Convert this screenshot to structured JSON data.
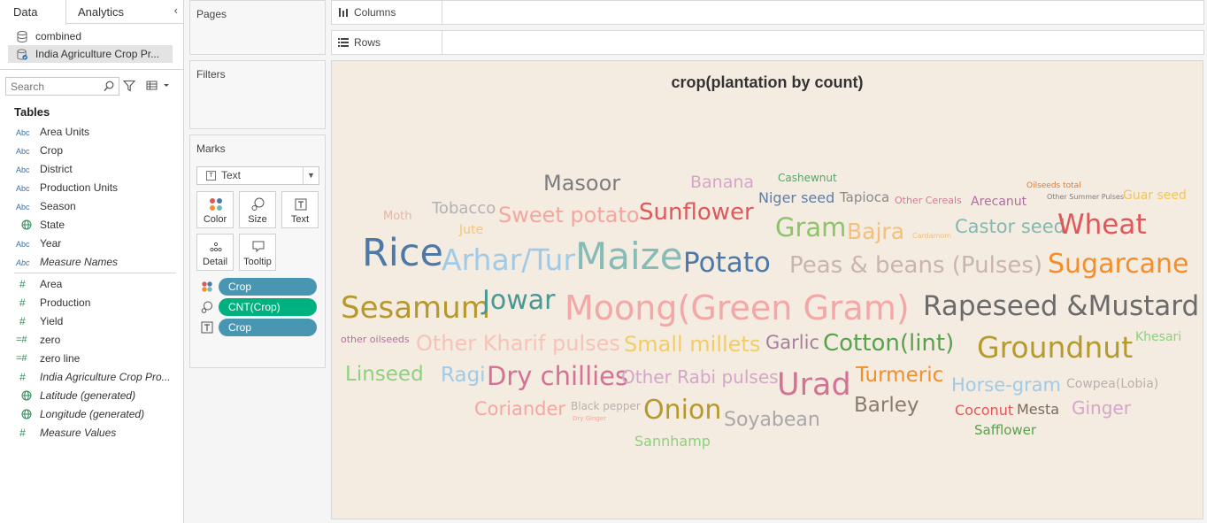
{
  "data_pane": {
    "tabs": {
      "data": "Data",
      "analytics": "Analytics"
    },
    "datasources": [
      {
        "name": "combined"
      },
      {
        "name": "India Agriculture Crop Pr..."
      }
    ],
    "search": {
      "placeholder": "Search"
    },
    "tables_heading": "Tables",
    "dimensions": [
      {
        "label": "Area Units",
        "type": "abc"
      },
      {
        "label": "Crop",
        "type": "abc"
      },
      {
        "label": "District",
        "type": "abc"
      },
      {
        "label": "Production Units",
        "type": "abc"
      },
      {
        "label": "Season",
        "type": "abc"
      },
      {
        "label": "State",
        "type": "geo"
      },
      {
        "label": "Year",
        "type": "abc"
      },
      {
        "label": "Measure Names",
        "type": "abc",
        "italic": true
      }
    ],
    "measures": [
      {
        "label": "Area",
        "type": "num"
      },
      {
        "label": "Production",
        "type": "num"
      },
      {
        "label": "Yield",
        "type": "num"
      },
      {
        "label": "zero",
        "type": "calc"
      },
      {
        "label": "zero line",
        "type": "calc"
      },
      {
        "label": "India Agriculture Crop Pro...",
        "type": "num",
        "italic": true
      },
      {
        "label": "Latitude (generated)",
        "type": "geo",
        "italic": true
      },
      {
        "label": "Longitude (generated)",
        "type": "geo",
        "italic": true
      },
      {
        "label": "Measure Values",
        "type": "num",
        "italic": true
      }
    ]
  },
  "cards": {
    "pages": "Pages",
    "filters": "Filters",
    "marks": {
      "title": "Marks",
      "mark_type": "Text",
      "buttons": {
        "color": "Color",
        "size": "Size",
        "text": "Text",
        "detail": "Detail",
        "tooltip": "Tooltip"
      },
      "pills": [
        {
          "label": "Crop",
          "kind": "color",
          "pill_color": "#4996b2"
        },
        {
          "label": "CNT(Crop)",
          "kind": "size",
          "pill_color": "#00b180"
        },
        {
          "label": "Crop",
          "kind": "text",
          "pill_color": "#4996b2"
        }
      ]
    }
  },
  "shelves": {
    "columns": "Columns",
    "rows": "Rows"
  },
  "viz": {
    "title": "crop(plantation by count)",
    "words": [
      {
        "text": "Masoor",
        "color": "#7d7d7d"
      },
      {
        "text": "Banana",
        "color": "#d4a6c8"
      },
      {
        "text": "Cashewnut",
        "color": "#59a36b"
      },
      {
        "text": "Niger seed",
        "color": "#5b7eaa"
      },
      {
        "text": "Tapioca",
        "color": "#8a8a8a"
      },
      {
        "text": "Other Cereals",
        "color": "#d47a95"
      },
      {
        "text": "Arecanut",
        "color": "#b06ea0"
      },
      {
        "text": "Oilseeds total",
        "color": "#e07a2e"
      },
      {
        "text": "Other Summer Pulses",
        "color": "#7d7d7d"
      },
      {
        "text": "Guar seed",
        "color": "#f1c659"
      },
      {
        "text": "Moth",
        "color": "#e5b5a5"
      },
      {
        "text": "Tobacco",
        "color": "#b3b3b3"
      },
      {
        "text": "Sweet potato",
        "color": "#f4a7a0"
      },
      {
        "text": "Sunflower",
        "color": "#e0585a"
      },
      {
        "text": "Gram",
        "color": "#8dc46a"
      },
      {
        "text": "Bajra",
        "color": "#f4c07a"
      },
      {
        "text": "Cardamom",
        "color": "#f4c07a"
      },
      {
        "text": "Castor seed",
        "color": "#86b8b0"
      },
      {
        "text": "Wheat",
        "color": "#e05759"
      },
      {
        "text": "Jute",
        "color": "#f7c479"
      },
      {
        "text": "Rice",
        "color": "#4e79a7"
      },
      {
        "text": "Arhar/Tur",
        "color": "#a0cbe8"
      },
      {
        "text": "Maize",
        "color": "#86bcb6"
      },
      {
        "text": "Potato",
        "color": "#4e79a7"
      },
      {
        "text": "Peas & beans (Pulses)",
        "color": "#c9b5b0"
      },
      {
        "text": "Sugarcane",
        "color": "#f28e2b"
      },
      {
        "text": "Sesamum",
        "color": "#b6992d"
      },
      {
        "text": "Jowar",
        "color": "#499894"
      },
      {
        "text": "Moong(Green Gram)",
        "color": "#f4a7a7"
      },
      {
        "text": "Rapeseed &Mustard",
        "color": "#6b6b6b"
      },
      {
        "text": "other oilseeds",
        "color": "#b16f9f"
      },
      {
        "text": "Other Kharif pulses",
        "color": "#f7c3b8"
      },
      {
        "text": "Small millets",
        "color": "#f1ce63"
      },
      {
        "text": "Garlic",
        "color": "#a67fa0"
      },
      {
        "text": "Cotton(lint)",
        "color": "#59a14f"
      },
      {
        "text": "Groundnut",
        "color": "#b69a2d"
      },
      {
        "text": "Khesari",
        "color": "#8cd17d"
      },
      {
        "text": "Linseed",
        "color": "#8cd17d"
      },
      {
        "text": "Ragi",
        "color": "#a0cbe8"
      },
      {
        "text": "Dry chillies",
        "color": "#d37295"
      },
      {
        "text": "Other Rabi pulses",
        "color": "#d4a6c8"
      },
      {
        "text": "Urad",
        "color": "#d37295"
      },
      {
        "text": "Turmeric",
        "color": "#f28e2b"
      },
      {
        "text": "Horse-gram",
        "color": "#a0cbe8"
      },
      {
        "text": "Cowpea(Lobia)",
        "color": "#bab0ac"
      },
      {
        "text": "Coriander",
        "color": "#f4a7a0"
      },
      {
        "text": "Black pepper",
        "color": "#bab0ac"
      },
      {
        "text": "Dry Ginger",
        "color": "#f4a7a0"
      },
      {
        "text": "Onion",
        "color": "#b6992d"
      },
      {
        "text": "Soyabean",
        "color": "#a8a8a8"
      },
      {
        "text": "Barley",
        "color": "#8a7b6a"
      },
      {
        "text": "Coconut",
        "color": "#e15759"
      },
      {
        "text": "Mesta",
        "color": "#7b6a5a"
      },
      {
        "text": "Ginger",
        "color": "#d4a6c8"
      },
      {
        "text": "Safflower",
        "color": "#59a14f"
      },
      {
        "text": "Sannhamp",
        "color": "#8cd17d"
      }
    ]
  }
}
